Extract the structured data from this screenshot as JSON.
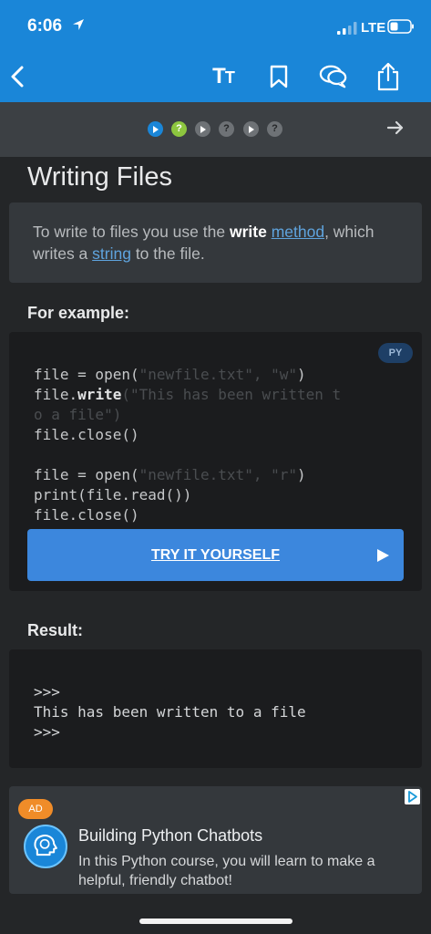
{
  "status_bar": {
    "time": "6:06",
    "network": "LTE",
    "icons": [
      "location-arrow-icon",
      "signal-icon",
      "battery-icon"
    ]
  },
  "nav_bar": {
    "text_size_label_big": "T",
    "text_size_label_small": "T",
    "icons": [
      "back-icon",
      "text-size-icon",
      "bookmark-icon",
      "comments-icon",
      "share-icon"
    ],
    "accent_color": "#1a86d8"
  },
  "progress": {
    "steps": [
      {
        "type": "play",
        "state": "active",
        "glyph": ""
      },
      {
        "type": "quiz",
        "state": "done",
        "glyph": "?"
      },
      {
        "type": "play",
        "state": "pending",
        "glyph": ""
      },
      {
        "type": "quiz",
        "state": "pending",
        "glyph": "?"
      },
      {
        "type": "play",
        "state": "pending",
        "glyph": ""
      },
      {
        "type": "quiz",
        "state": "pending",
        "glyph": "?"
      }
    ],
    "next_icon": "arrow-right-icon"
  },
  "lesson": {
    "title": "Writing Files",
    "intro": {
      "part1": "To write to files you use the ",
      "bold": "write",
      "part2": " ",
      "link1": "method",
      "part3": ", which writes a ",
      "link2": "string",
      "part4": " to the file."
    },
    "example_label": "For example:",
    "language_badge": "PY",
    "code_lines": [
      {
        "a": "file = open(",
        "s": "\"newfile.txt\", \"w\"",
        "b": ")"
      },
      {
        "a": "file.",
        "k": "write",
        "s": "(\"This has been written to a file\")"
      },
      {
        "a": "file.close()"
      },
      {
        "a": ""
      },
      {
        "a": "file = open(",
        "s": "\"newfile.txt\", \"r\"",
        "b": ")"
      },
      {
        "a": "print(file.read())"
      },
      {
        "a": "file.close()"
      }
    ],
    "try_button_label": "TRY IT YOURSELF",
    "result_label": "Result:",
    "result_lines": [
      ">>>",
      "This has been written to a file",
      ">>>"
    ]
  },
  "ad": {
    "badge": "AD",
    "title": "Building Python Chatbots",
    "description": "In this Python course, you will learn to make a helpful, friendly chatbot!",
    "badge_color": "#f08c28"
  }
}
